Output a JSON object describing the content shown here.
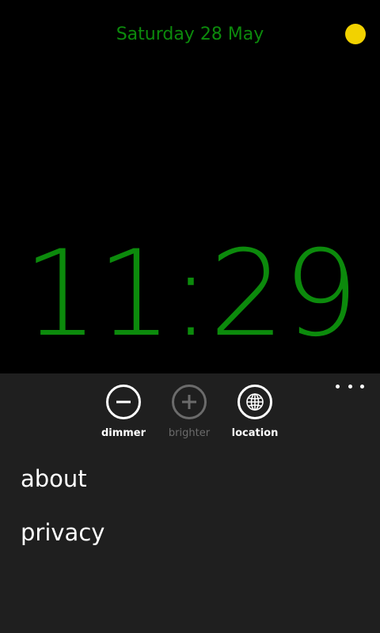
{
  "clock": {
    "date": "Saturday 28 May",
    "time": "11:29",
    "status_dot_color": "#f2d200",
    "text_color": "#0c8a0c"
  },
  "app_bar": {
    "more_icon": "ellipsis-icon",
    "buttons": [
      {
        "label": "dimmer",
        "icon": "minus-circle-icon",
        "enabled": true
      },
      {
        "label": "brighter",
        "icon": "plus-circle-icon",
        "enabled": false
      },
      {
        "label": "location",
        "icon": "globe-icon",
        "enabled": true
      }
    ],
    "menu_items": [
      {
        "label": "about"
      },
      {
        "label": "privacy"
      }
    ]
  }
}
